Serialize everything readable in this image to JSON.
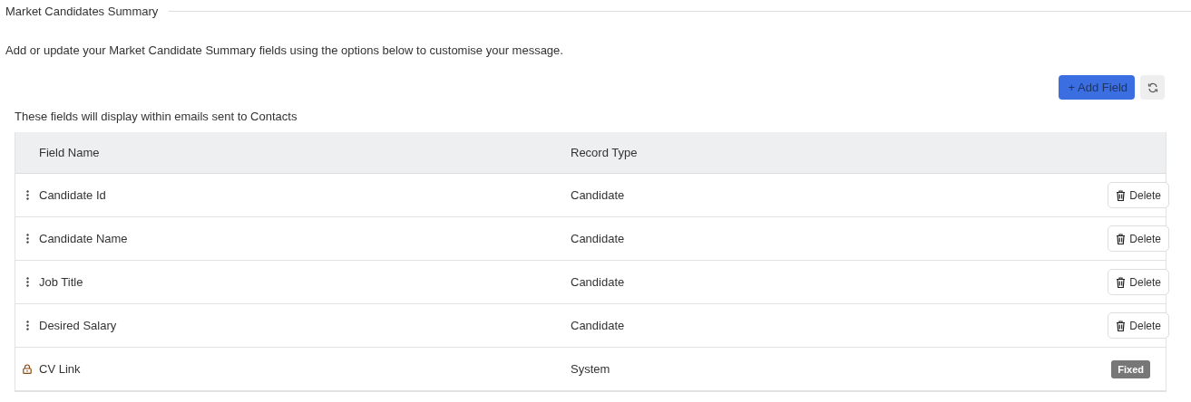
{
  "section": {
    "title": "Market Candidates Summary",
    "description": "Add or update your Market Candidate Summary fields using the options below to customise your message."
  },
  "toolbar": {
    "add_button": "+ Add Field"
  },
  "table": {
    "caption": "These fields will display within emails sent to Contacts",
    "columns": [
      "Field Name",
      "Record Type"
    ],
    "rows": [
      {
        "kind": "draggable",
        "name": "Candidate Id",
        "record_type": "Candidate",
        "action": {
          "kind": "delete",
          "label": "Delete"
        }
      },
      {
        "kind": "draggable",
        "name": "Candidate Name",
        "record_type": "Candidate",
        "action": {
          "kind": "delete",
          "label": "Delete"
        }
      },
      {
        "kind": "draggable",
        "name": "Job Title",
        "record_type": "Candidate",
        "action": {
          "kind": "delete",
          "label": "Delete"
        }
      },
      {
        "kind": "draggable",
        "name": "Desired Salary",
        "record_type": "Candidate",
        "action": {
          "kind": "delete",
          "label": "Delete"
        }
      },
      {
        "kind": "locked",
        "name": "CV Link",
        "record_type": "System",
        "action": {
          "kind": "fixed",
          "label": "Fixed"
        }
      }
    ]
  }
}
